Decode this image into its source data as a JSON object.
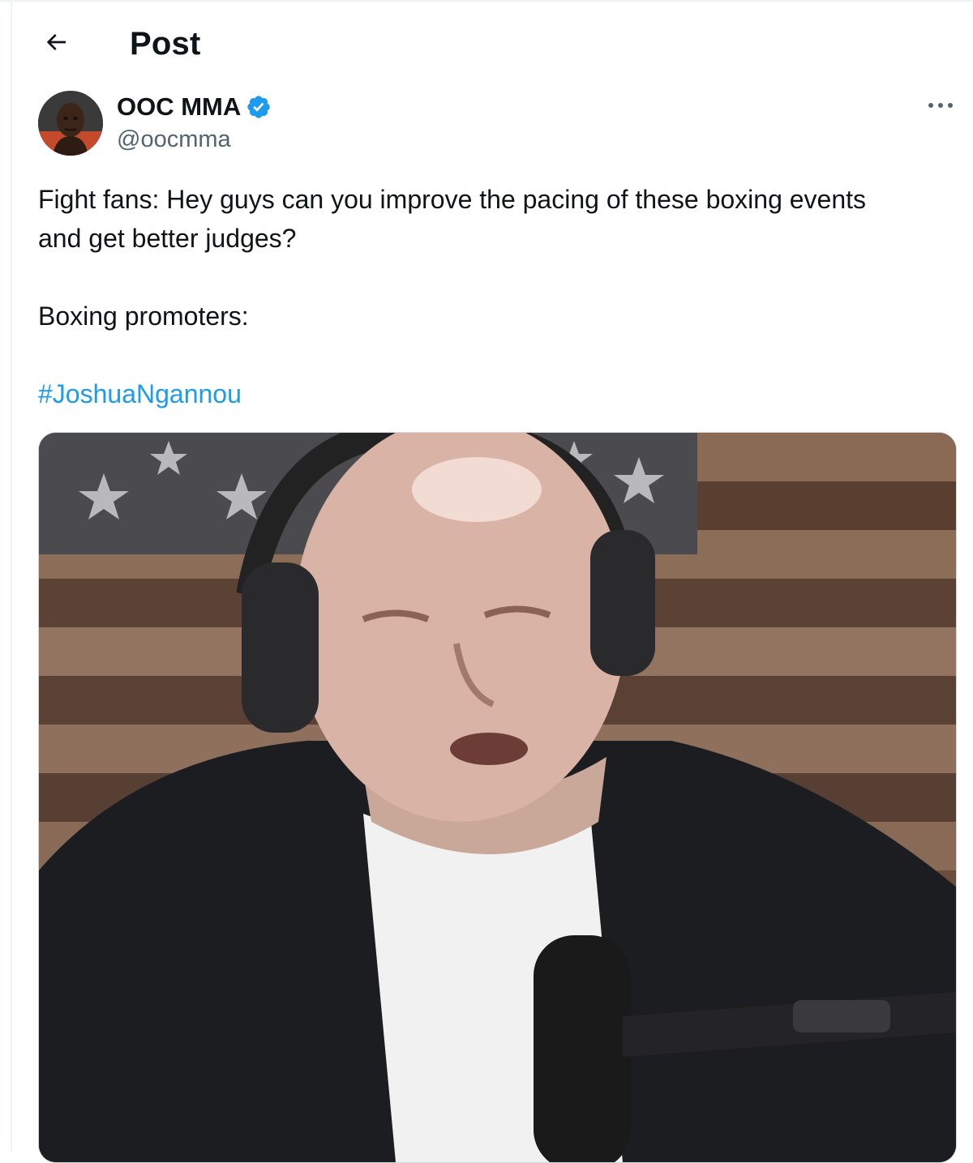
{
  "header": {
    "back_icon": "arrow-left-icon",
    "title": "Post"
  },
  "post": {
    "author": {
      "name": "OOC MMA",
      "verified": true,
      "verified_icon": "verified-badge-icon",
      "handle": "@oocmma",
      "avatar_icon": "avatar-photo"
    },
    "more_icon": "more-options-icon",
    "text_line1": "Fight fans: Hey guys can you improve the pacing of these boxing events",
    "text_line2": "and get better judges?",
    "text_line3": "Boxing promoters:",
    "hashtag": "#JoshuaNgannou",
    "media": {
      "type": "video-still",
      "description_icon": "media-image"
    }
  },
  "colors": {
    "text": "#0f1419",
    "secondary": "#536471",
    "link": "#1d9bf0",
    "border": "#cfd9de"
  }
}
